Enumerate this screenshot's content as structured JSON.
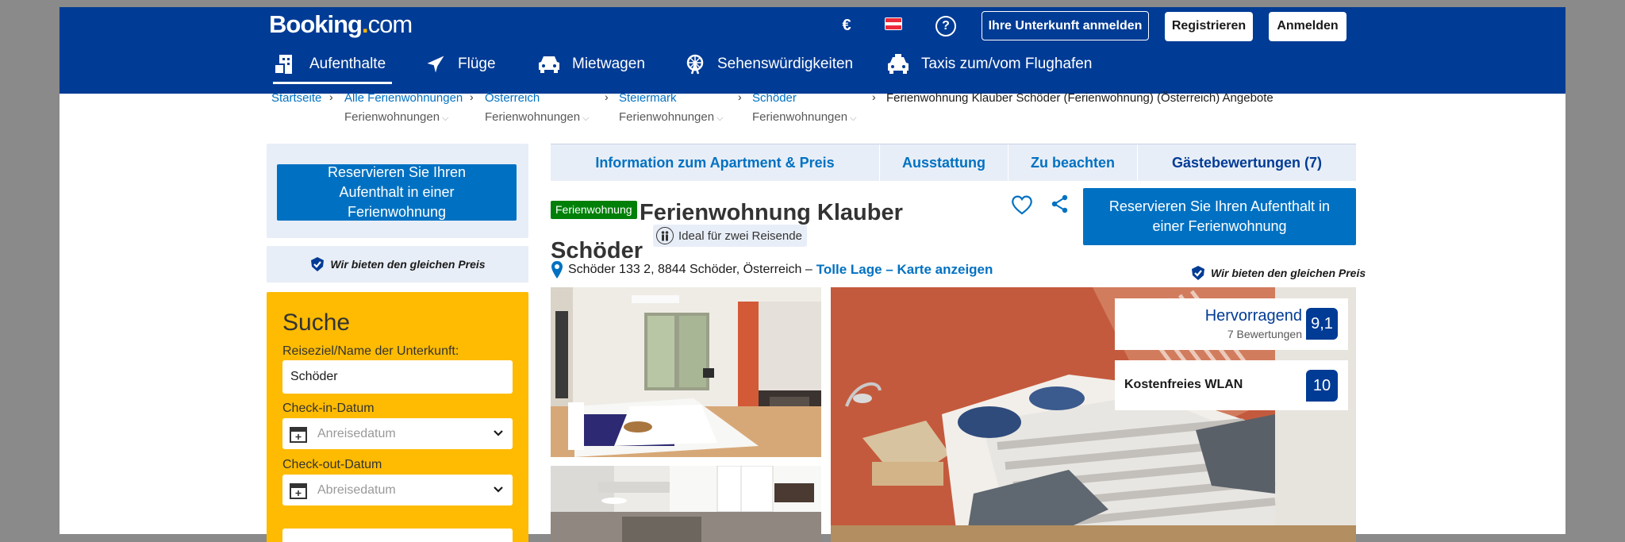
{
  "header": {
    "logo_main": "Booking",
    "logo_dot": ".",
    "logo_tld": "com",
    "currency": "€",
    "help": "?",
    "list_property": "Ihre Unterkunft anmelden",
    "register": "Registrieren",
    "sign_in": "Anmelden",
    "flag_colors": [
      "#ed2939",
      "#ffffff",
      "#ed2939"
    ]
  },
  "nav": [
    {
      "label": "Aufenthalte",
      "icon": "bed-building-icon",
      "active": true
    },
    {
      "label": "Flüge",
      "icon": "plane-icon"
    },
    {
      "label": "Mietwagen",
      "icon": "car-icon"
    },
    {
      "label": "Sehenswürdigkeiten",
      "icon": "ferris-wheel-icon"
    },
    {
      "label": "Taxis zum/vom Flughafen",
      "icon": "taxi-icon"
    }
  ],
  "breadcrumb": {
    "home": "Startseite",
    "items": [
      {
        "label": "Alle Ferienwohnungen",
        "sub": "Ferienwohnungen"
      },
      {
        "label": "Österreich",
        "sub": "Ferienwohnungen"
      },
      {
        "label": "Steiermark",
        "sub": "Ferienwohnungen"
      },
      {
        "label": "Schöder",
        "sub": "Ferienwohnungen"
      }
    ],
    "current": "Ferienwohnung Klauber Schöder (Ferienwohnung) (Österreich) Angebote"
  },
  "sidebar": {
    "reserve": "Reservieren Sie Ihren Aufenthalt in einer Ferienwohnung",
    "price_match": "Wir bieten den gleichen Preis",
    "search": {
      "title": "Suche",
      "destination_label": "Reiseziel/Name der Unterkunft:",
      "destination_value": "Schöder",
      "checkin_label": "Check-in-Datum",
      "checkin_placeholder": "Anreisedatum",
      "checkout_label": "Check-out-Datum",
      "checkout_placeholder": "Abreisedatum"
    }
  },
  "tabs": [
    {
      "label": "Information zum Apartment & Preis"
    },
    {
      "label": "Ausstattung"
    },
    {
      "label": "Zu beachten"
    },
    {
      "label": "Gästebewertungen (7)"
    }
  ],
  "property": {
    "type_badge": "Ferienwohnung",
    "name": "Ferienwohnung Klauber Schöder",
    "ideal": "Ideal für zwei Reisende",
    "reserve": "Reservieren Sie Ihren Aufenthalt in einer Ferienwohnung",
    "address": "Schöder 133 2, 8844 Schöder, Österreich –",
    "map_link": "Tolle Lage – Karte anzeigen",
    "price_match": "Wir bieten den gleichen Preis"
  },
  "reviews": {
    "word": "Hervorragend",
    "count": "7 Bewertungen",
    "score": "9,1",
    "wifi_label": "Kostenfreies WLAN",
    "wifi_score": "10"
  },
  "colors": {
    "brand": "#003b95",
    "cta": "#0071c2",
    "search_bg": "#febb02",
    "badge_green": "#008009",
    "light_blue": "#e8eef7"
  }
}
